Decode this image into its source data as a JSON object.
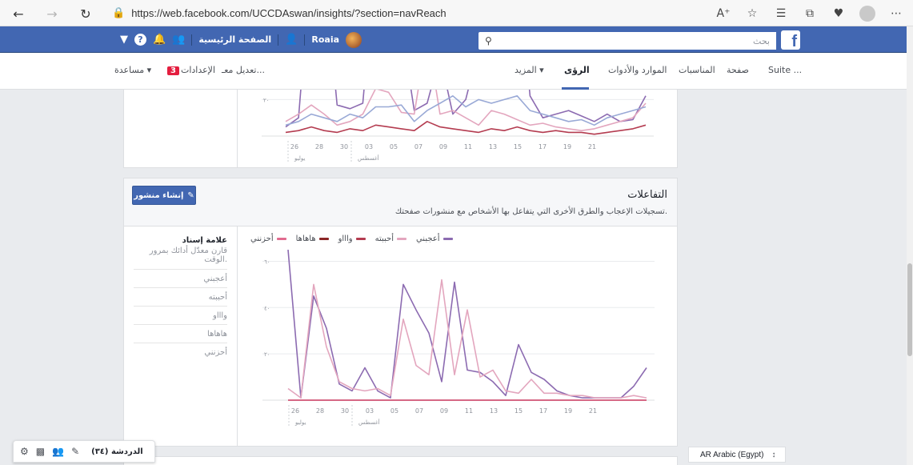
{
  "browser": {
    "url": "https://web.facebook.com/UCCDAswan/insights/?section=navReach",
    "back_icon": "arrow-left-icon",
    "forward_icon": "arrow-right-icon",
    "refresh_icon": "refresh-icon",
    "lock_icon": "lock-icon"
  },
  "fb_header": {
    "search_placeholder": "بحث",
    "home_label": "الصفحة الرئيسية",
    "user_name": "Roaia",
    "logo_letter": "f"
  },
  "page_tabs": {
    "items": [
      {
        "label": "Suite ...",
        "active": false
      },
      {
        "label": "صفحة",
        "active": false
      },
      {
        "label": "المناسبات",
        "active": false
      },
      {
        "label": "الموارد والأدوات",
        "active": false
      },
      {
        "label": "الرؤى",
        "active": true
      },
      {
        "label": "المزيد ▾",
        "active": false
      }
    ],
    "edit_label": "تعديل معـ...",
    "settings_label": "الإعدادات",
    "settings_badge": "3",
    "help_label": "مساعدة ▾"
  },
  "reactions_card": {
    "title": "التفاعلات",
    "subtitle": "تسجيلات الإعجاب والطرق الأخرى التي يتفاعل بها الأشخاص مع منشورات صفحتك.",
    "create_post_label": "إنشاء منشور",
    "benchmark_title": "علامة إسناد",
    "benchmark_sub": "قارن معدّل أدائك بمرور الوقت.",
    "benchmark_items": [
      "أعجبني",
      "أحببته",
      "واااو",
      "هاهاها",
      "أحزنني"
    ],
    "legend": [
      {
        "label": "أعجبني",
        "color": "#8c6bb1"
      },
      {
        "label": "أحببته",
        "color": "#e3a6be"
      },
      {
        "label": "واااو",
        "color": "#b43c50"
      },
      {
        "label": "هاهاها",
        "color": "#8b2626"
      },
      {
        "label": "أحزنني",
        "color": "#e16b8f"
      }
    ]
  },
  "chat": {
    "label": "الدردشة (٣٤)"
  },
  "language": {
    "label": "AR Arabic (Egypt)"
  },
  "chart_data": [
    {
      "type": "line",
      "x": [
        "26",
        "28",
        "30",
        "03",
        "05",
        "07",
        "09",
        "11",
        "13",
        "15",
        "17",
        "19",
        "21"
      ],
      "x_group_labels": [
        "يوليو",
        "أغسطس"
      ],
      "ytick_label": "٢٠",
      "series": [
        {
          "color": "#8c6bb1",
          "values": [
            5,
            10,
            98,
            92,
            17,
            15,
            18,
            98,
            72,
            60,
            14,
            18,
            44,
            12,
            20,
            48,
            52,
            65,
            98,
            22,
            10,
            12,
            14,
            11,
            8,
            12,
            8,
            9,
            22
          ]
        },
        {
          "color": "#e3a6be",
          "values": [
            8,
            12,
            17,
            12,
            6,
            8,
            12,
            26,
            24,
            13,
            12,
            56,
            12,
            14,
            10,
            6,
            14,
            12,
            9,
            6,
            7,
            5,
            4,
            3,
            4,
            6,
            8,
            10,
            18
          ]
        },
        {
          "color": "#99a9d6",
          "values": [
            6,
            8,
            12,
            10,
            8,
            12,
            10,
            16,
            16,
            17,
            8,
            14,
            18,
            22,
            16,
            20,
            18,
            20,
            22,
            14,
            12,
            10,
            8,
            9,
            6,
            10,
            12,
            14,
            16
          ]
        },
        {
          "color": "#b43c50",
          "values": [
            2,
            3,
            5,
            3,
            2,
            4,
            3,
            6,
            5,
            4,
            3,
            8,
            5,
            4,
            3,
            2,
            4,
            3,
            5,
            3,
            2,
            3,
            2,
            2,
            1,
            2,
            3,
            4,
            6
          ]
        }
      ]
    },
    {
      "type": "line",
      "x": [
        "26",
        "28",
        "30",
        "03",
        "05",
        "07",
        "09",
        "11",
        "13",
        "15",
        "17",
        "19",
        "21"
      ],
      "x_group_labels": [
        "يوليو",
        "أغسطس"
      ],
      "ytick_labels": [
        "٢٠",
        "٤٠",
        "٦٠"
      ],
      "ylim": [
        0,
        65
      ],
      "series": [
        {
          "name": "أعجبني",
          "color": "#8c6bb1",
          "values": [
            65,
            1,
            45,
            31,
            7,
            4,
            14,
            4,
            1,
            50,
            39,
            29,
            8,
            51,
            13,
            12,
            8,
            2,
            24,
            12,
            9,
            4,
            2,
            1,
            1,
            1,
            1,
            6,
            14
          ]
        },
        {
          "name": "أحببته",
          "color": "#e3a6be",
          "values": [
            5,
            1,
            50,
            23,
            8,
            5,
            4,
            5,
            2,
            35,
            15,
            11,
            52,
            11,
            39,
            10,
            13,
            4,
            3,
            9,
            3,
            3,
            2,
            2,
            1,
            1,
            1,
            2,
            1
          ]
        },
        {
          "name": "واااو",
          "color": "#b43c50",
          "values": [
            0,
            0,
            0,
            0,
            0,
            0,
            0,
            0,
            0,
            0,
            0,
            0,
            0,
            0,
            0,
            0,
            0,
            0,
            0,
            0,
            0,
            0,
            0,
            0,
            0,
            0,
            0,
            0,
            0
          ]
        },
        {
          "name": "هاهاها",
          "color": "#8b2626",
          "values": [
            0,
            0,
            0,
            0,
            0,
            0,
            0,
            0,
            0,
            0,
            0,
            0,
            0,
            0,
            0,
            0,
            0,
            0,
            0,
            0,
            0,
            0,
            0,
            0,
            0,
            0,
            0,
            0,
            0
          ]
        },
        {
          "name": "أحزنني",
          "color": "#e16b8f",
          "values": [
            0,
            0,
            0,
            0,
            0,
            0,
            0,
            0,
            0,
            0,
            0,
            0,
            0,
            0,
            0,
            0,
            0,
            0,
            0,
            0,
            0,
            0,
            0,
            0,
            0,
            0,
            0,
            0,
            0
          ]
        }
      ]
    }
  ]
}
